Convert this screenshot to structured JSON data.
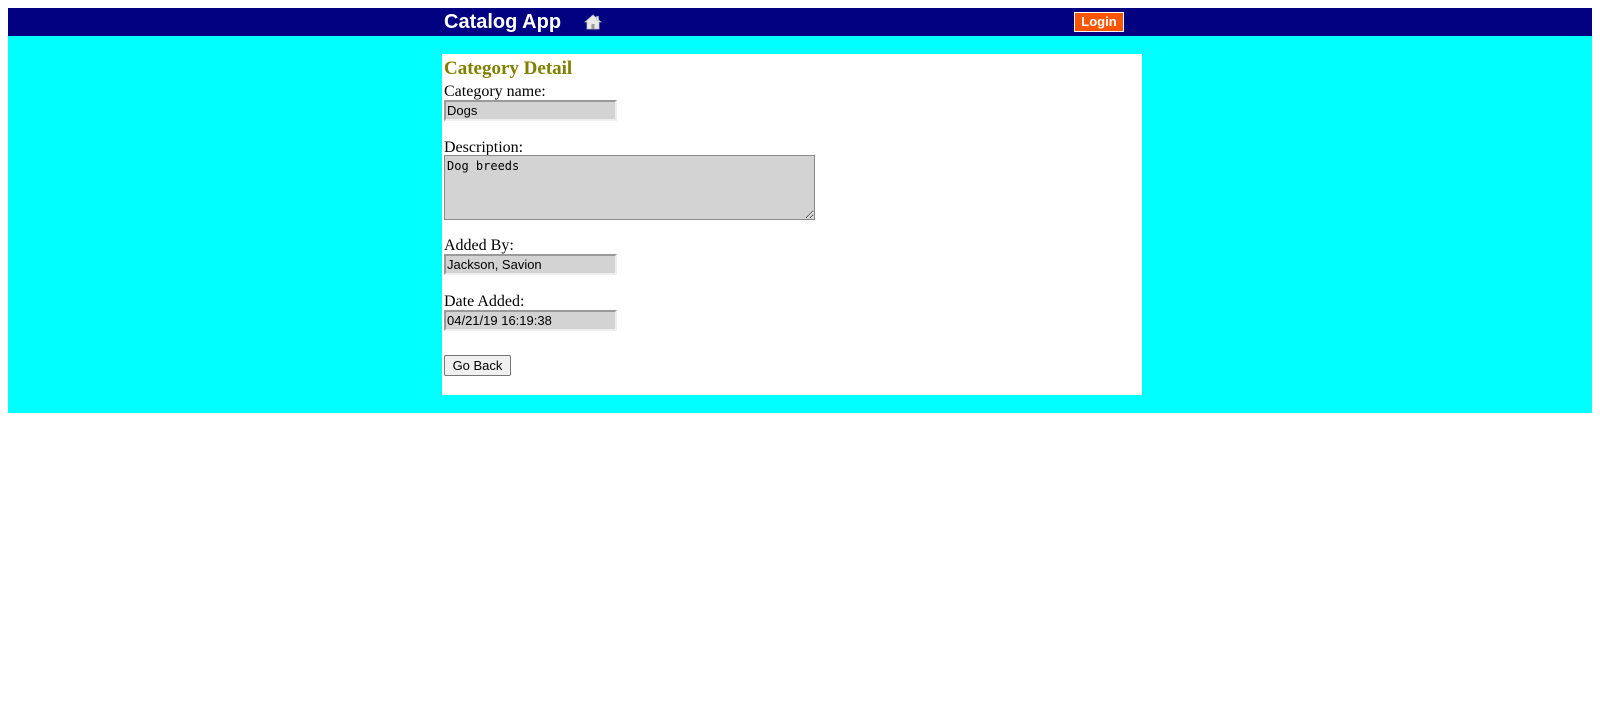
{
  "header": {
    "app_title": "Catalog App",
    "home_icon": "home-icon",
    "login_label": "Login"
  },
  "colors": {
    "header_bg": "#000080",
    "main_bg": "#00ffff",
    "title_color": "#808000",
    "login_bg": "#ff5500",
    "field_bg": "#d3d3d3"
  },
  "detail": {
    "title": "Category Detail",
    "fields": {
      "category_name": {
        "label": "Category name:",
        "value": "Dogs"
      },
      "description": {
        "label": "Description:",
        "value": "Dog breeds"
      },
      "added_by": {
        "label": "Added By:",
        "value": "Jackson, Savion"
      },
      "date_added": {
        "label": "Date Added:",
        "value": "04/21/19 16:19:38"
      }
    },
    "back_label": "Go Back"
  }
}
